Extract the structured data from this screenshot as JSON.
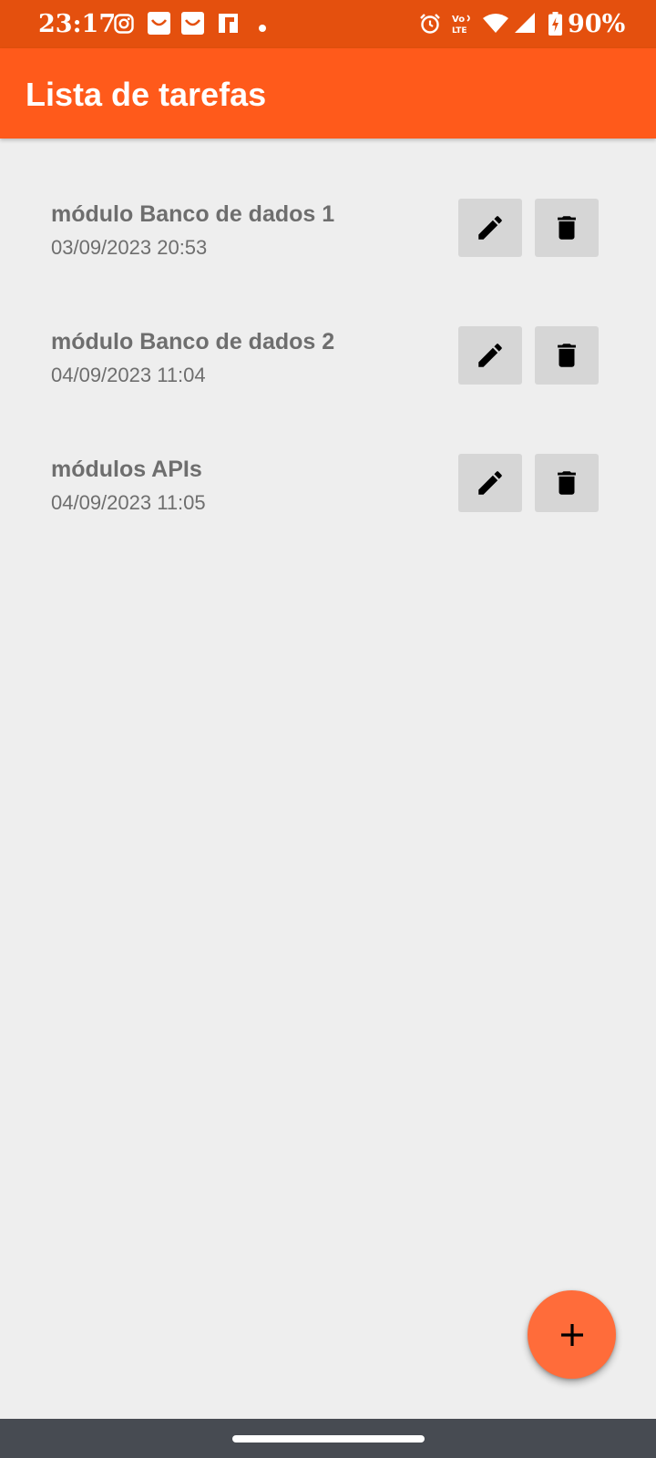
{
  "status_bar": {
    "time": "23:17",
    "battery": "90%",
    "left_icons": [
      "instagram-icon",
      "shopping-bag-icon",
      "shopping-bag-icon",
      "flipboard-icon",
      "dot-icon"
    ],
    "right_icons": [
      "alarm-icon",
      "volte-icon",
      "wifi-icon",
      "signal-icon",
      "battery-charging-icon"
    ],
    "color": "#E4500E"
  },
  "app_bar": {
    "title": "Lista de tarefas",
    "color": "#FF5A1B"
  },
  "tasks": [
    {
      "title": "módulo Banco de dados 1",
      "date": "03/09/2023 20:53"
    },
    {
      "title": "módulo Banco de dados 2",
      "date": "04/09/2023 11:04"
    },
    {
      "title": "módulos APIs",
      "date": "04/09/2023 11:05"
    }
  ],
  "task_actions": {
    "edit_icon": "pencil-icon",
    "delete_icon": "trash-icon"
  },
  "fab": {
    "icon": "plus-icon",
    "color": "#FF6C3A"
  },
  "nav_bar": {
    "color": "#474B52"
  }
}
